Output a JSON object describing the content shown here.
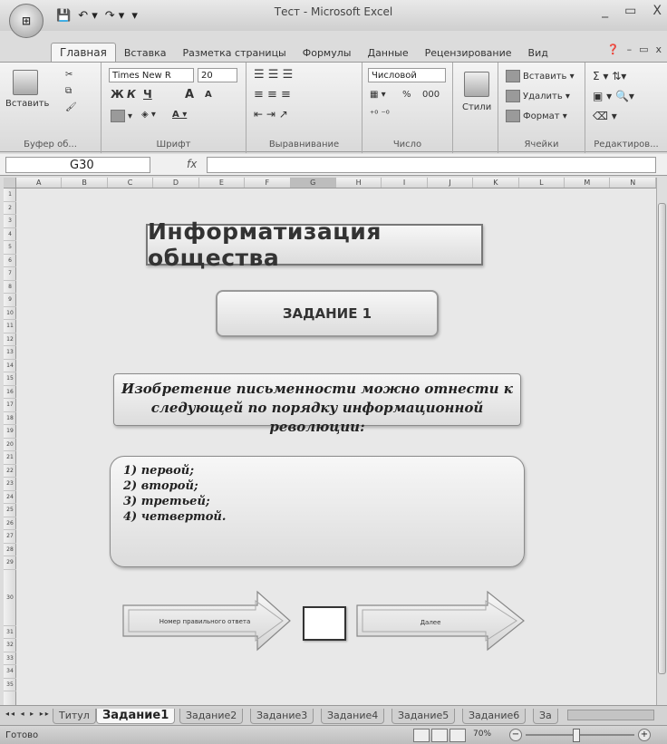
{
  "window": {
    "title": "Тест - Microsoft Excel",
    "controls": [
      "_",
      "▭",
      "X"
    ]
  },
  "quick_access": {
    "icons": [
      "save-icon",
      "undo-icon",
      "redo-icon",
      "customize-icon"
    ]
  },
  "ribbon_tabs": [
    "Главная",
    "Вставка",
    "Разметка страницы",
    "Формулы",
    "Данные",
    "Рецензирование",
    "Вид"
  ],
  "ribbon": {
    "clipboard": {
      "paste_label": "Вставить",
      "group_label": "Буфер об..."
    },
    "font": {
      "font_name": "Times New R",
      "font_size": "20",
      "bold": "Ж",
      "italic": "К",
      "underline": "Ч",
      "grow": "A",
      "shrink": "A",
      "group_label": "Шрифт"
    },
    "alignment": {
      "group_label": "Выравнивание"
    },
    "number": {
      "format": "Числовой",
      "percent": "%",
      "thousands": "000",
      "group_label": "Число"
    },
    "styles": {
      "label": "Стили"
    },
    "cells": {
      "insert": "Вставить",
      "delete": "Удалить",
      "format": "Формат",
      "group_label": "Ячейки"
    },
    "editing": {
      "group_label": "Редактиров..."
    }
  },
  "formula_bar": {
    "name_box": "G30",
    "fx_label": "fx",
    "value": ""
  },
  "columns": [
    "A",
    "B",
    "C",
    "D",
    "E",
    "F",
    "G",
    "H",
    "I",
    "J",
    "K",
    "L",
    "M",
    "N"
  ],
  "selected_column": "G",
  "rows": [
    "1",
    "2",
    "3",
    "4",
    "5",
    "6",
    "7",
    "8",
    "9",
    "10",
    "11",
    "12",
    "13",
    "14",
    "15",
    "16",
    "17",
    "18",
    "19",
    "20",
    "21",
    "22",
    "23",
    "24",
    "25",
    "26",
    "27",
    "28",
    "29",
    "30",
    "31",
    "32",
    "33",
    "34",
    "35"
  ],
  "sheet": {
    "title": "Информатизация  общества",
    "task": "ЗАДАНИЕ 1",
    "question_line1": "Изобретение письменности можно отнести к",
    "question_line2": "следующей по порядку информационной революции:",
    "answers": [
      "1) первой;",
      "2) второй;",
      "3) третьей;",
      "4) четвертой."
    ],
    "answer_label": "Номер правильного  ответа",
    "answer_value": "",
    "next_label": "Далее"
  },
  "sheet_tabs": [
    "Титул",
    "Задание1",
    "Задание2",
    "Задание3",
    "Задание4",
    "Задание5",
    "Задание6",
    "За"
  ],
  "active_sheet": "Задание1",
  "status": {
    "text": "Готово",
    "zoom": "70%"
  }
}
